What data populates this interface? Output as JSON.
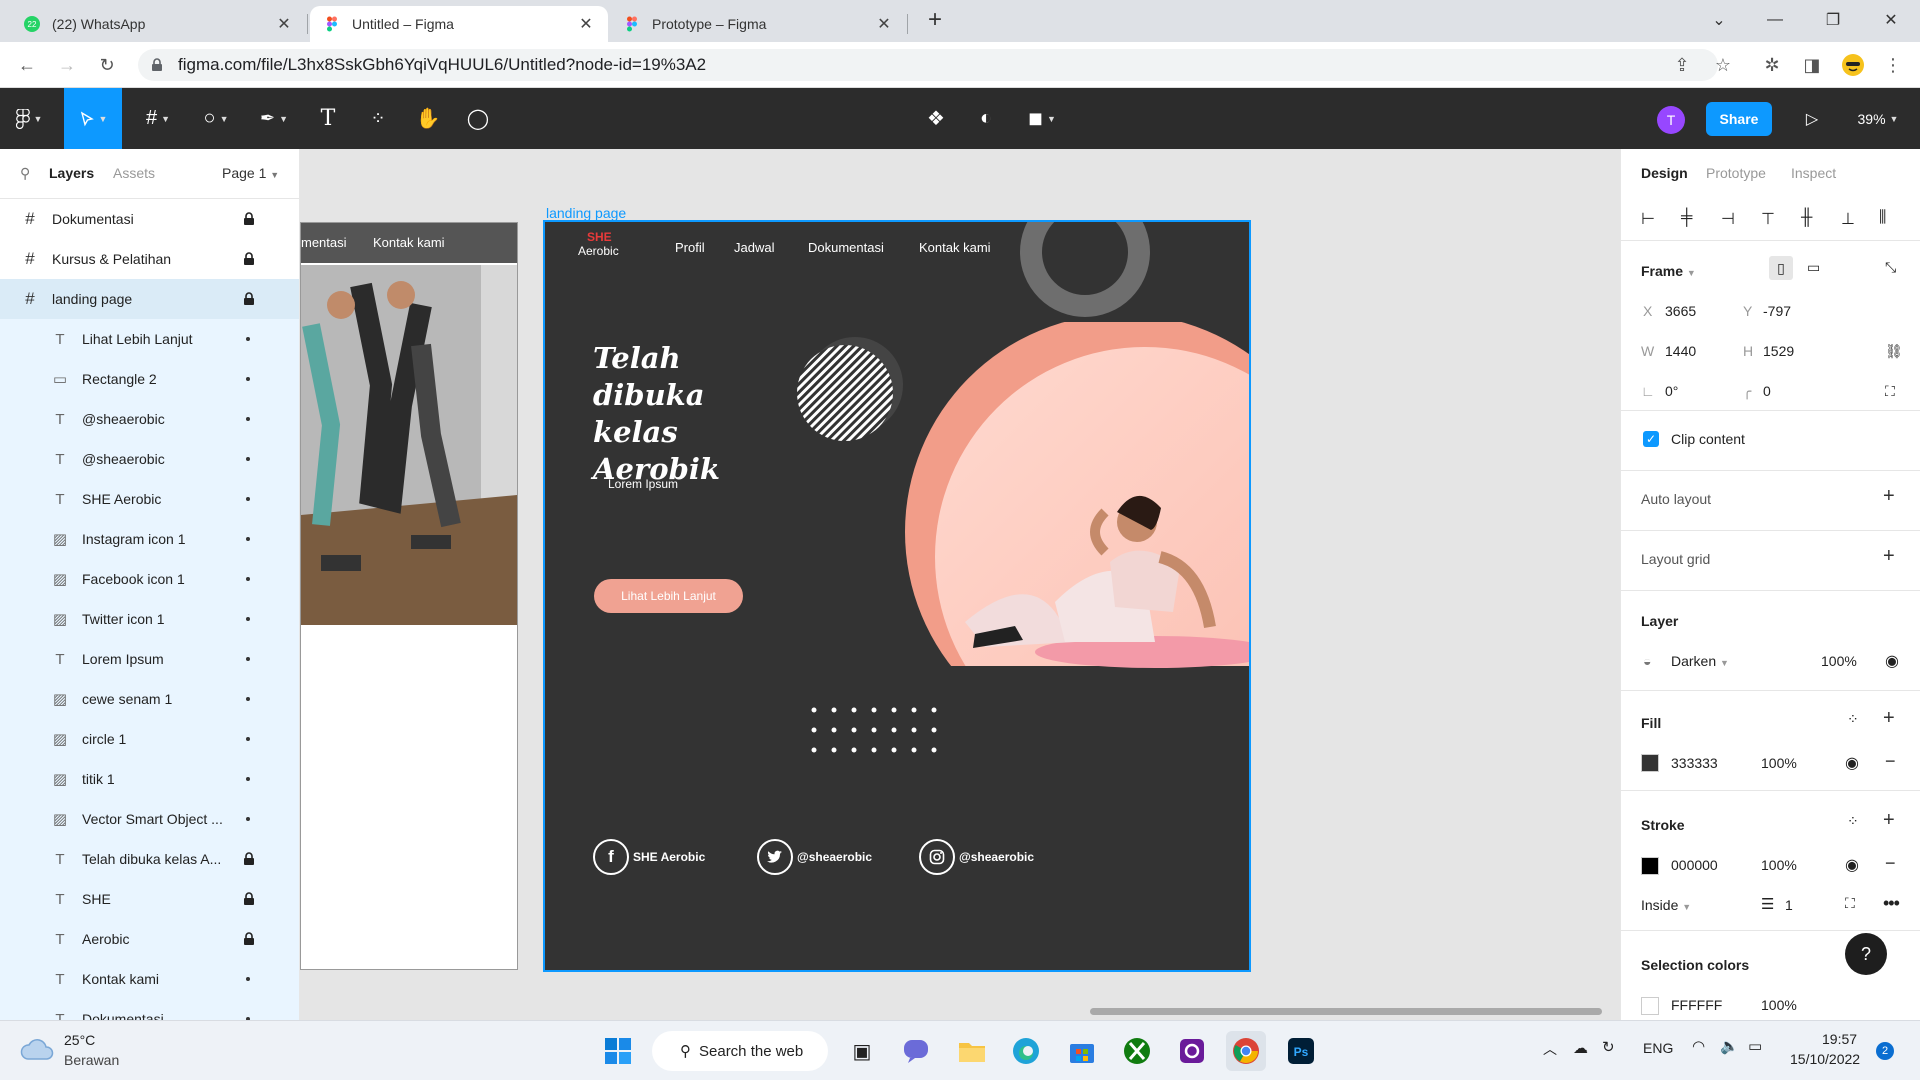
{
  "browser": {
    "tabs": [
      {
        "title": "(22) WhatsApp",
        "badge": "22"
      },
      {
        "title": "Untitled – Figma"
      },
      {
        "title": "Prototype – Figma"
      }
    ],
    "url": "figma.com/file/L3hx8SskGbh6YqiVqHUUL6/Untitled?node-id=19%3A2"
  },
  "figma": {
    "avatar_initial": "T",
    "share_label": "Share",
    "zoom": "39%"
  },
  "left_panel": {
    "tab_layers": "Layers",
    "tab_assets": "Assets",
    "page": "Page 1",
    "top_layers": [
      {
        "name": "Dokumentasi",
        "locked": true
      },
      {
        "name": "Kursus & Pelatihan",
        "locked": true
      },
      {
        "name": "landing page",
        "locked": true
      }
    ],
    "children": [
      {
        "name": "Lihat Lebih Lanjut",
        "type": "text",
        "locked": false
      },
      {
        "name": "Rectangle 2",
        "type": "rect",
        "locked": false
      },
      {
        "name": "@sheaerobic",
        "type": "text",
        "locked": false
      },
      {
        "name": "@sheaerobic",
        "type": "text",
        "locked": false
      },
      {
        "name": "SHE Aerobic",
        "type": "text",
        "locked": false
      },
      {
        "name": "Instagram icon 1",
        "type": "image",
        "locked": false
      },
      {
        "name": "Facebook icon 1",
        "type": "image",
        "locked": false
      },
      {
        "name": "Twitter icon 1",
        "type": "image",
        "locked": false
      },
      {
        "name": "Lorem Ipsum",
        "type": "text",
        "locked": false
      },
      {
        "name": "cewe senam 1",
        "type": "image",
        "locked": false
      },
      {
        "name": "circle 1",
        "type": "image",
        "locked": false
      },
      {
        "name": "titik 1",
        "type": "image",
        "locked": false
      },
      {
        "name": "Vector Smart Object ...",
        "type": "image",
        "locked": false
      },
      {
        "name": "Telah dibuka kelas A...",
        "type": "text",
        "locked": true
      },
      {
        "name": "SHE",
        "type": "text",
        "locked": true
      },
      {
        "name": "Aerobic",
        "type": "text",
        "locked": true
      },
      {
        "name": "Kontak kami",
        "type": "text",
        "locked": false
      },
      {
        "name": "Dokumentasi",
        "type": "text",
        "locked": false
      }
    ]
  },
  "canvas": {
    "frame_label": "landing page",
    "back_nav": {
      "left": "mentasi",
      "right": "Kontak kami"
    },
    "artboard": {
      "logo_she": "SHE",
      "logo_aerobic": "Aerobic",
      "nav": [
        "Profil",
        "Jadwal",
        "Dokumentasi",
        "Kontak kami"
      ],
      "hero_title": "Telah dibuka kelas Aerobik",
      "hero_sub": "Lorem Ipsum",
      "cta": "Lihat Lebih Lanjut",
      "socials": [
        {
          "icon": "facebook-icon",
          "label": "SHE Aerobic"
        },
        {
          "icon": "twitter-icon",
          "label": "@sheaerobic"
        },
        {
          "icon": "instagram-icon",
          "label": "@sheaerobic"
        }
      ]
    }
  },
  "right_panel": {
    "tabs": [
      "Design",
      "Prototype",
      "Inspect"
    ],
    "frame_label": "Frame",
    "x_label": "X",
    "x": "3665",
    "y_label": "Y",
    "y": "-797",
    "w_label": "W",
    "w": "1440",
    "h_label": "H",
    "h": "1529",
    "rotation": "0°",
    "radius": "0",
    "clip_content": "Clip content",
    "auto_layout": "Auto layout",
    "layout_grid": "Layout grid",
    "layer_title": "Layer",
    "blend": "Darken",
    "layer_opacity": "100%",
    "fill_title": "Fill",
    "fill_hex": "333333",
    "fill_opacity": "100%",
    "fill_color": "#333333",
    "stroke_title": "Stroke",
    "stroke_hex": "000000",
    "stroke_opacity": "100%",
    "stroke_color": "#000000",
    "stroke_position": "Inside",
    "stroke_width": "1",
    "selection_colors": "Selection colors",
    "sel_hex": "FFFFFF",
    "sel_opacity": "100%",
    "help": "?"
  },
  "taskbar": {
    "temperature": "25°C",
    "weather": "Berawan",
    "search": "Search the web",
    "language": "ENG",
    "time": "19:57",
    "date": "15/10/2022",
    "notifications": "2"
  },
  "colors": {
    "accent": "#0d99ff",
    "artboard_bg": "#333333",
    "peach": "#f0a292",
    "logo_red": "#e83a3a"
  }
}
